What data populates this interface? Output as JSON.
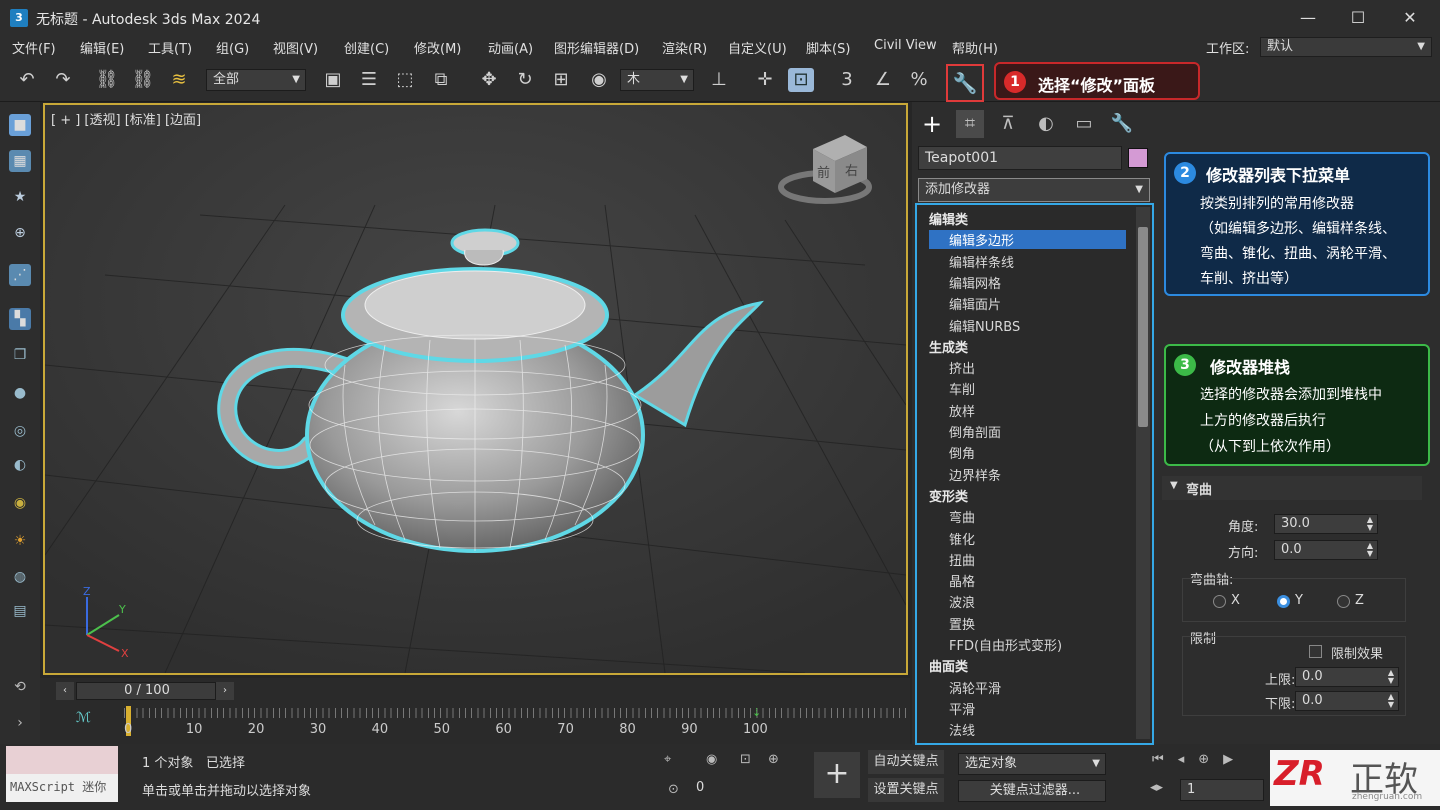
{
  "window": {
    "title": "无标题 - Autodesk 3ds Max 2024",
    "app_icon": "3"
  },
  "menu": [
    "文件(F)",
    "编辑(E)",
    "工具(T)",
    "组(G)",
    "视图(V)",
    "创建(C)",
    "修改(M)",
    "动画(A)",
    "图形编辑器(D)",
    "渲染(R)",
    "自定义(U)",
    "脚本(S)",
    "Civil View",
    "帮助(H)"
  ],
  "workspace": {
    "label": "工作区:",
    "value": "默认"
  },
  "toolbar": {
    "selection_filter": "全部",
    "ref_coord": "⽊"
  },
  "callout1": {
    "num": "1",
    "text": "选择“修改”面板"
  },
  "callout2": {
    "num": "2",
    "title": "修改器列表下拉菜单",
    "body": [
      "按类别排列的常用修改器",
      "（如编辑多边形、编辑样条线、",
      "弯曲、锥化、扭曲、涡轮平滑、",
      "车削、挤出等）"
    ]
  },
  "callout3": {
    "num": "3",
    "title": "修改器堆栈",
    "body": [
      "选择的修改器会添加到堆栈中",
      "上方的修改器后执行",
      "（从下到上依次作用）"
    ]
  },
  "viewport": {
    "label": "[ + ] [透视] [标准] [边面]",
    "viewcube": {
      "front": "前",
      "right": "右"
    },
    "axes": {
      "z": "Z",
      "y": "Y",
      "x": "X"
    }
  },
  "object": {
    "name": "Teapot001",
    "color": "#d49ad4"
  },
  "modifier_dropdown": "添加修改器",
  "modifier_list": [
    {
      "cat": "编辑类",
      "items": [
        "编辑多边形",
        "编辑样条线",
        "编辑网格",
        "编辑面片",
        "编辑NURBS"
      ]
    },
    {
      "cat": "生成类",
      "items": [
        "挤出",
        "车削",
        "放样",
        "倒角剖面",
        "倒角",
        "边界样条"
      ]
    },
    {
      "cat": "变形类",
      "items": [
        "弯曲",
        "锥化",
        "扭曲",
        "晶格",
        "波浪",
        "置换",
        "FFD(自由形式变形)"
      ]
    },
    {
      "cat": "曲面类",
      "items": [
        "涡轮平滑",
        "平滑",
        "法线"
      ]
    }
  ],
  "bend": {
    "title": "弯曲",
    "angle_label": "角度:",
    "angle": "30.0",
    "dir_label": "方向:",
    "dir": "0.0",
    "axis_label": "弯曲轴:",
    "axes": [
      "X",
      "Y",
      "Z"
    ],
    "selected_axis": "Y",
    "limit_label": "限制",
    "limit_effect": "限制效果",
    "upper_label": "上限:",
    "upper": "0.0",
    "lower_label": "下限:",
    "lower": "0.0"
  },
  "timeline": {
    "frame": "0 / 100",
    "ticks": [
      "0",
      "10",
      "20",
      "30",
      "40",
      "50",
      "60",
      "70",
      "80",
      "90",
      "100"
    ]
  },
  "status": {
    "maxscript": "MAXScript 迷你",
    "objects": "1 个对象",
    "selected": "已选择",
    "hint": "单击或单击并拖动以选择对象",
    "auto_key": "自动关键点",
    "set_key": "设置关键点",
    "selected_obj": "选定对象",
    "key_filter": "关键点过滤器...",
    "frame_field": "0",
    "time_field": "1"
  },
  "watermark": {
    "text": "正软",
    "sub": "zhengruan.com"
  }
}
